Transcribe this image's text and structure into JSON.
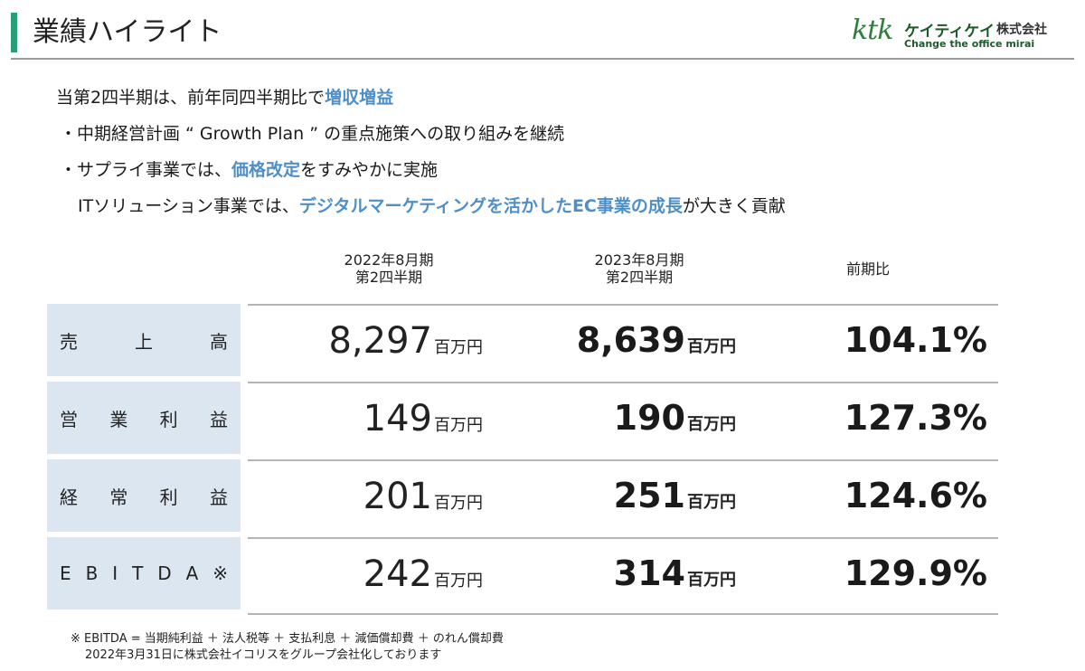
{
  "header": {
    "title": "業績ハイライト",
    "logo_mark": "ktk",
    "logo_kana": "ケイティケイ",
    "logo_corp": "株式会社",
    "logo_tagline": "Change the office mirai",
    "accent_color": "#27a07a"
  },
  "summary": {
    "line1_pre": "当第2四半期は、前年同四半期比で",
    "line1_hl": "増収増益",
    "line2": "・中期経営計画 “ Growth Plan ” の重点施策への取り組みを継続",
    "line3_pre": "・サプライ事業では、",
    "line3_hl": "価格改定",
    "line3_post": "をすみやかに実施",
    "line4_pre": "ITソリューション事業では、",
    "line4_hl": "デジタルマーケティングを活かしたEC事業の成長",
    "line4_post": "が大きく貢献",
    "highlight_color": "#4f8fc9"
  },
  "table": {
    "columns": [
      {
        "line1": "2022年8月期",
        "line2": "第2四半期"
      },
      {
        "line1": "2023年8月期",
        "line2": "第2四半期"
      },
      {
        "line1": "前期比"
      }
    ],
    "unit": "百万円",
    "rows": [
      {
        "label": "売　上　高",
        "prev": "8,297",
        "curr": "8,639",
        "ratio": "104.1%"
      },
      {
        "label": "営　業　利　益",
        "prev": "149",
        "curr": "190",
        "ratio": "127.3%"
      },
      {
        "label": "経　常　利　益",
        "prev": "201",
        "curr": "251",
        "ratio": "124.6%"
      },
      {
        "label": "E B I T D A ※",
        "prev": "242",
        "curr": "314",
        "ratio": "129.9%"
      }
    ]
  },
  "footnote": {
    "line1": "※ EBITDA = 当期純利益 ＋ 法人税等 ＋ 支払利息 ＋ 減価償却費 ＋ のれん償却費",
    "line2": "2022年3月31日に株式会社イコリスをグループ会社化しております"
  }
}
